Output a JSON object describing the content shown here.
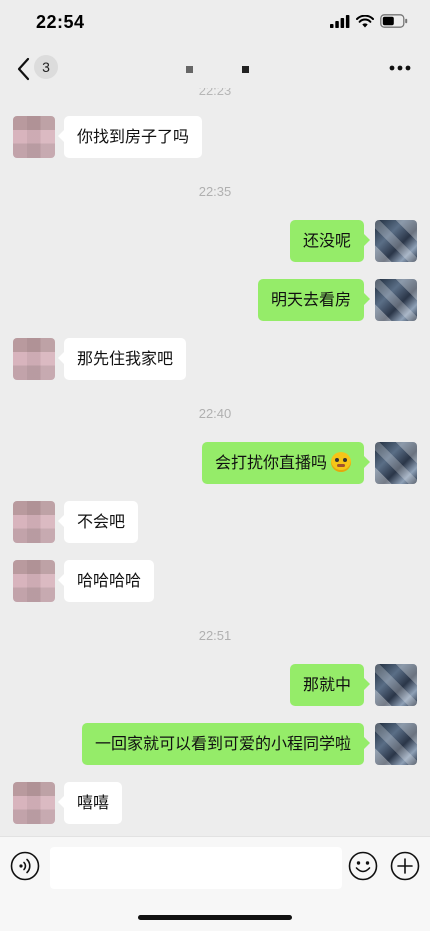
{
  "status_bar": {
    "time": "22:54"
  },
  "nav": {
    "unread_count": "3"
  },
  "timestamps": {
    "t0": "22:23",
    "t1": "22:35",
    "t2": "22:40",
    "t3": "22:51"
  },
  "messages": [
    {
      "side": "in",
      "text": "你找到房子了吗"
    },
    {
      "side": "out",
      "text": "还没呢"
    },
    {
      "side": "out",
      "text": "明天去看房"
    },
    {
      "side": "in",
      "text": "那先住我家吧"
    },
    {
      "side": "out",
      "text": "会打扰你直播吗"
    },
    {
      "side": "in",
      "text": "不会吧"
    },
    {
      "side": "in",
      "text": "哈哈哈哈"
    },
    {
      "side": "out",
      "text": "那就中"
    },
    {
      "side": "out",
      "text": "一回家就可以看到可爱的小程同学啦"
    },
    {
      "side": "in",
      "text": "嘻嘻"
    }
  ],
  "icons": {
    "back": "chevron-left-icon",
    "more": "more-dots-icon",
    "voice": "voice-icon",
    "emoji": "emoji-icon",
    "plus": "plus-icon"
  },
  "colors": {
    "bubble_out": "#95ec69",
    "bubble_in": "#ffffff",
    "background": "#ededed"
  }
}
